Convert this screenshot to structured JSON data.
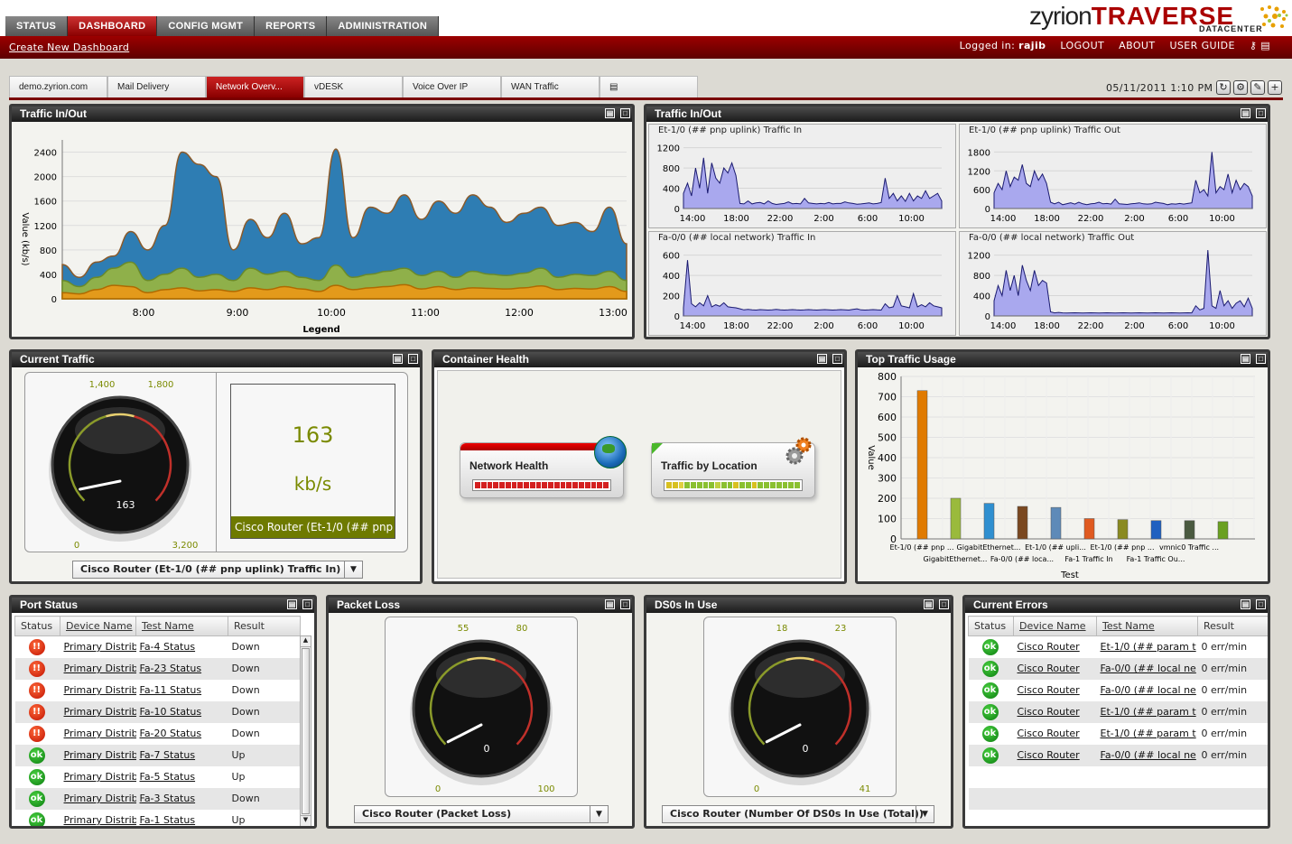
{
  "nav": {
    "tabs": [
      "STATUS",
      "DASHBOARD",
      "CONFIG MGMT",
      "REPORTS",
      "ADMINISTRATION"
    ],
    "active": "DASHBOARD",
    "create_link": "Create New Dashboard"
  },
  "logo": {
    "brand1": "zyrion",
    "brand2": "TRAVERSE",
    "sub": "DATACENTER"
  },
  "user": {
    "logged_in_label": "Logged in:",
    "username": "rajib",
    "logout": "LOGOUT",
    "about": "ABOUT",
    "user_guide": "USER GUIDE"
  },
  "dash_tabs": [
    "demo.zyrion.com",
    "Mail Delivery",
    "Network Overv...",
    "vDESK",
    "Voice Over IP",
    "WAN Traffic"
  ],
  "active_dash_tab": "Network Overv...",
  "datetime": "05/11/2011 1:10 PM",
  "colors": {
    "accent": "#8a0000",
    "ok": "#1a9a1a",
    "down": "#d42a00",
    "area_blue": "#2e7db3",
    "area_green": "#8fb04a",
    "area_orange": "#e39a1b",
    "mini_fill": "#a9a8ee"
  },
  "panels": {
    "traffic1": {
      "title": "Traffic In/Out",
      "ylabel": "Value (kb/s)",
      "xlabel": "Legend"
    },
    "traffic2": {
      "title": "Traffic In/Out"
    },
    "current_traffic": {
      "title": "Current Traffic",
      "select": "Cisco Router (Et-1/0 (## pnp uplink) Traffic In)"
    },
    "container_health": {
      "title": "Container Health",
      "box1": "Network Health",
      "box2": "Traffic by Location"
    },
    "top_traffic": {
      "title": "Top Traffic Usage"
    },
    "port_status": {
      "title": "Port Status"
    },
    "packet_loss": {
      "title": "Packet Loss",
      "select": "Cisco Router (Packet Loss)"
    },
    "ds0s": {
      "title": "DS0s In Use",
      "select": "Cisco Router (Number Of DS0s In Use (Total))"
    },
    "current_errors": {
      "title": "Current Errors"
    }
  },
  "gauges": {
    "current_traffic": {
      "value": 163,
      "min": 0,
      "max": 3200,
      "mark1": "1,400",
      "mark2": "1,800",
      "min_label": "0",
      "max_label": "3,200",
      "display_value": "163",
      "unit": "kb/s",
      "device": "Cisco Router (Et-1/0 (## pnp u..."
    },
    "packet_loss": {
      "value": 0,
      "min": 0,
      "max": 100,
      "mark1": "55",
      "mark2": "80",
      "min_label": "0",
      "max_label": "100",
      "display_value": "0"
    },
    "ds0s": {
      "value": 0,
      "min": 0,
      "max": 41,
      "mark1": "18",
      "mark2": "23",
      "min_label": "0",
      "max_label": "41",
      "display_value": "0"
    }
  },
  "port_table": {
    "headers": [
      "Status",
      "Device Name",
      "Test Name",
      "Result"
    ],
    "rows": [
      {
        "status": "down",
        "device": "Primary Distrib",
        "test": "Fa-4 Status",
        "result": "Down"
      },
      {
        "status": "down",
        "device": "Primary Distrib",
        "test": "Fa-23 Status",
        "result": "Down"
      },
      {
        "status": "down",
        "device": "Primary Distrib",
        "test": "Fa-11 Status",
        "result": "Down"
      },
      {
        "status": "down",
        "device": "Primary Distrib",
        "test": "Fa-10 Status",
        "result": "Down"
      },
      {
        "status": "down",
        "device": "Primary Distrib",
        "test": "Fa-20 Status",
        "result": "Down"
      },
      {
        "status": "ok",
        "device": "Primary Distrib",
        "test": "Fa-7 Status",
        "result": "Up"
      },
      {
        "status": "ok",
        "device": "Primary Distrib",
        "test": "Fa-5 Status",
        "result": "Up"
      },
      {
        "status": "ok",
        "device": "Primary Distrib",
        "test": "Fa-3 Status",
        "result": "Down"
      },
      {
        "status": "ok",
        "device": "Primary Distrib",
        "test": "Fa-1 Status",
        "result": "Up"
      }
    ]
  },
  "error_table": {
    "headers": [
      "Status",
      "Device Name",
      "Test Name",
      "Result"
    ],
    "rows": [
      {
        "status": "ok",
        "device": "Cisco Router",
        "test": "Et-1/0 (## param t",
        "result": "0 err/min"
      },
      {
        "status": "ok",
        "device": "Cisco Router",
        "test": "Fa-0/0 (## local ne",
        "result": "0 err/min"
      },
      {
        "status": "ok",
        "device": "Cisco Router",
        "test": "Fa-0/0 (## local ne",
        "result": "0 err/min"
      },
      {
        "status": "ok",
        "device": "Cisco Router",
        "test": "Et-1/0 (## param t",
        "result": "0 err/min"
      },
      {
        "status": "ok",
        "device": "Cisco Router",
        "test": "Et-1/0 (## param t",
        "result": "0 err/min"
      },
      {
        "status": "ok",
        "device": "Cisco Router",
        "test": "Fa-0/0 (## local ne",
        "result": "0 err/min"
      }
    ]
  },
  "status_glyphs": {
    "down": "!!",
    "ok": "ok"
  },
  "chart_data": [
    {
      "type": "area",
      "x_ticks": [
        "8:00",
        "9:00",
        "10:00",
        "11:00",
        "12:00",
        "13:00"
      ],
      "ylabel": "Value (kb/s)",
      "xlabel": "Legend",
      "ylim": [
        0,
        2600
      ],
      "y_ticks": [
        0,
        400,
        800,
        1200,
        1600,
        2000,
        2400
      ],
      "series": [
        {
          "values": [
            560,
            350,
            600,
            700,
            1100,
            800,
            1200,
            2400,
            2200,
            2000,
            800,
            1300,
            1000,
            1400,
            900,
            1000,
            2450,
            1000,
            1500,
            1400,
            1700,
            1300,
            1600,
            1400,
            1700,
            1500,
            1250,
            1400,
            1500,
            1200,
            1250,
            1100,
            1500,
            900
          ]
        },
        {
          "values": [
            300,
            200,
            350,
            500,
            600,
            300,
            400,
            500,
            350,
            400,
            300,
            500,
            400,
            450,
            350,
            300,
            550,
            350,
            400,
            450,
            500,
            380,
            450,
            350,
            450,
            400,
            380,
            420,
            500,
            350,
            400,
            380,
            450,
            300
          ]
        },
        {
          "values": [
            100,
            80,
            150,
            220,
            200,
            100,
            150,
            180,
            130,
            150,
            120,
            180,
            150,
            200,
            160,
            120,
            220,
            150,
            180,
            200,
            230,
            160,
            200,
            150,
            180,
            170,
            160,
            180,
            210,
            150,
            170,
            160,
            200,
            120
          ]
        }
      ]
    },
    {
      "type": "area",
      "title": "Et-1/0 (## pnp uplink) Traffic In",
      "x_ticks": [
        "14:00",
        "18:00",
        "22:00",
        "2:00",
        "6:00",
        "10:00"
      ],
      "y_ticks": [
        0,
        400,
        800,
        1200
      ],
      "ylim": [
        0,
        1300
      ],
      "values": [
        300,
        500,
        250,
        800,
        400,
        1000,
        300,
        900,
        600,
        500,
        800,
        700,
        900,
        650,
        100,
        90,
        150,
        90,
        110,
        120,
        90,
        150,
        100,
        80,
        90,
        100,
        130,
        95,
        100,
        90,
        200,
        110,
        100,
        90,
        100,
        95,
        120,
        90,
        100,
        100,
        130,
        110,
        100,
        85,
        90,
        100,
        110,
        90,
        100,
        120,
        600,
        200,
        300,
        150,
        250,
        140,
        300,
        150,
        250,
        200,
        350,
        200,
        250,
        300,
        150
      ]
    },
    {
      "type": "area",
      "title": "Et-1/0 (## pnp uplink) Traffic Out",
      "x_ticks": [
        "14:00",
        "18:00",
        "22:00",
        "2:00",
        "6:00",
        "10:00"
      ],
      "y_ticks": [
        0,
        600,
        1200,
        1800
      ],
      "ylim": [
        0,
        2100
      ],
      "values": [
        500,
        800,
        600,
        1200,
        700,
        1000,
        900,
        1400,
        800,
        700,
        1200,
        900,
        1100,
        800,
        200,
        150,
        200,
        120,
        150,
        180,
        140,
        200,
        150,
        120,
        150,
        160,
        200,
        150,
        160,
        140,
        300,
        150,
        140,
        130,
        150,
        160,
        180,
        150,
        140,
        150,
        200,
        180,
        160,
        120,
        150,
        140,
        160,
        140,
        160,
        180,
        900,
        500,
        600,
        400,
        1800,
        500,
        700,
        600,
        1100,
        500,
        900,
        600,
        800,
        700,
        400
      ]
    },
    {
      "type": "area",
      "title": "Fa-0/0 (## local network) Traffic In",
      "x_ticks": [
        "14:00",
        "18:00",
        "22:00",
        "2:00",
        "6:00",
        "10:00"
      ],
      "y_ticks": [
        0,
        200,
        400,
        600
      ],
      "ylim": [
        0,
        650
      ],
      "values": [
        80,
        550,
        120,
        90,
        130,
        100,
        200,
        90,
        110,
        95,
        130,
        90,
        85,
        80,
        70,
        60,
        65,
        60,
        58,
        62,
        60,
        58,
        60,
        65,
        60,
        58,
        60,
        62,
        60,
        58,
        60,
        62,
        60,
        58,
        60,
        62,
        60,
        58,
        60,
        62,
        60,
        58,
        65,
        70,
        60,
        58,
        60,
        62,
        60,
        58,
        120,
        80,
        90,
        200,
        100,
        90,
        80,
        220,
        90,
        110,
        90,
        130,
        100,
        90,
        80
      ]
    },
    {
      "type": "area",
      "title": "Fa-0/0 (## local network) Traffic Out",
      "x_ticks": [
        "14:00",
        "18:00",
        "22:00",
        "2:00",
        "6:00",
        "10:00"
      ],
      "y_ticks": [
        0,
        400,
        800,
        1200
      ],
      "ylim": [
        0,
        1300
      ],
      "values": [
        300,
        600,
        400,
        900,
        500,
        800,
        400,
        1000,
        700,
        500,
        900,
        600,
        700,
        650,
        80,
        60,
        70,
        60,
        58,
        60,
        62,
        60,
        58,
        60,
        62,
        60,
        58,
        60,
        62,
        60,
        58,
        60,
        62,
        60,
        58,
        60,
        62,
        60,
        58,
        60,
        62,
        60,
        58,
        60,
        62,
        60,
        58,
        60,
        62,
        60,
        200,
        120,
        150,
        1300,
        200,
        150,
        500,
        200,
        300,
        150,
        250,
        300,
        180,
        350,
        150
      ]
    },
    {
      "type": "bar",
      "ylabel": "Value",
      "xlabel": "Test",
      "ylim": [
        0,
        800
      ],
      "y_ticks": [
        0,
        100,
        200,
        300,
        400,
        500,
        600,
        700,
        800
      ],
      "categories": [
        "Et-1/0 (## pnp ...",
        "GigabitEthernet...",
        "GigabitEthernet...",
        "Fa-0/0 (## loca...",
        "Et-1/0 (## upli...",
        "Fa-1 Traffic In",
        "Et-1/0 (## pnp ...",
        "Fa-1 Traffic Ou...",
        "vmnic0 Traffic ...",
        ""
      ],
      "values": [
        730,
        200,
        175,
        160,
        155,
        100,
        95,
        90,
        90,
        85
      ],
      "colors": [
        "#e07a00",
        "#9aba3c",
        "#2f8fd0",
        "#7a4820",
        "#5e8ab8",
        "#e05a20",
        "#8a8a20",
        "#2060c0",
        "#4a5a40",
        "#6aa020"
      ]
    }
  ]
}
